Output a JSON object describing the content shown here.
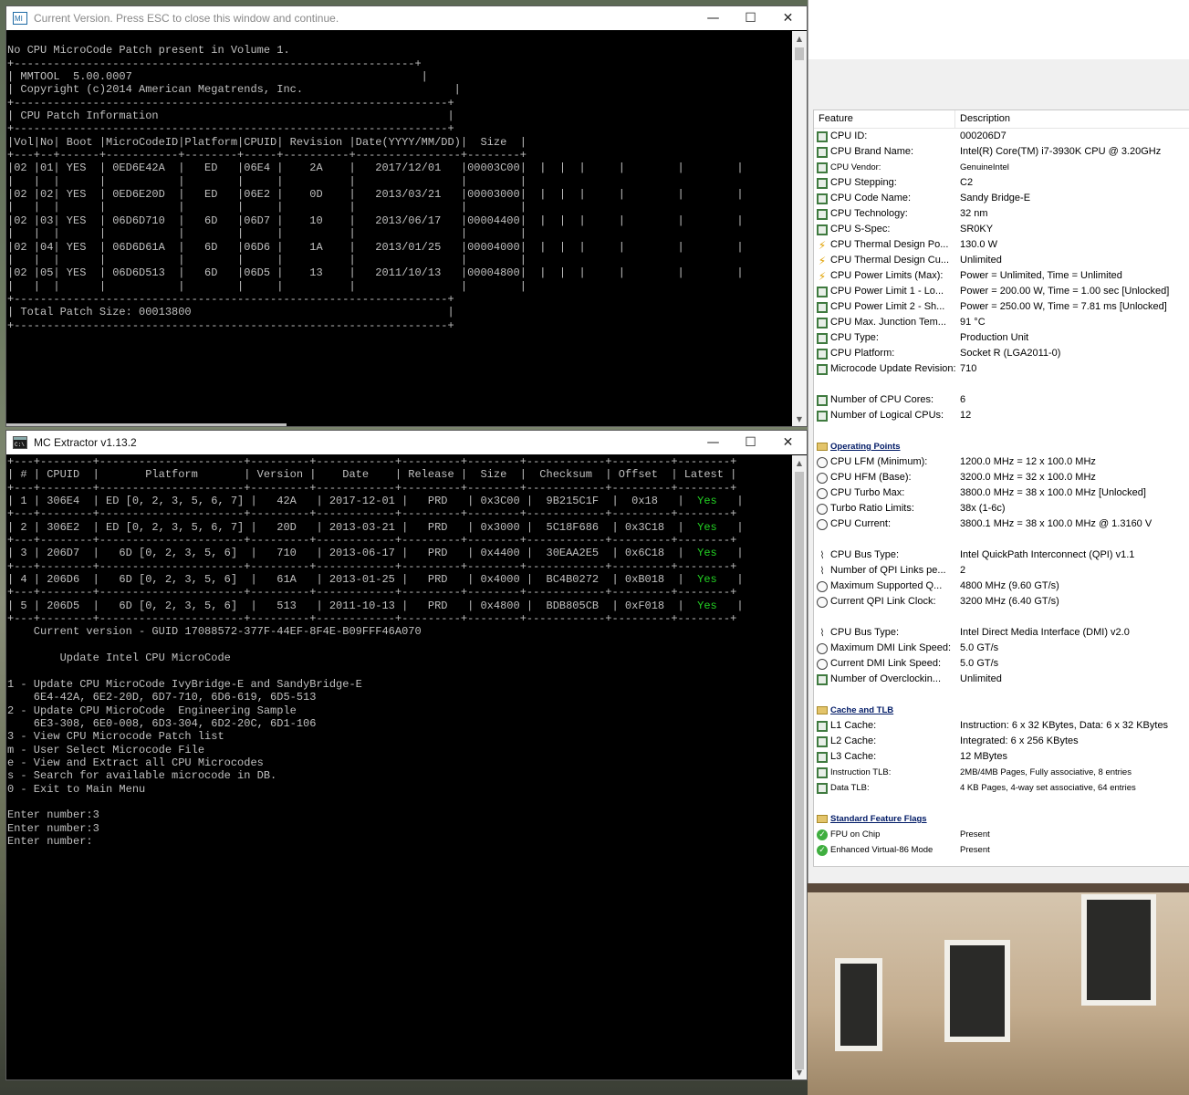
{
  "mmtool_window": {
    "title": "Current Version. Press ESC to close this window and continue.",
    "controls": {
      "minimize": "—",
      "maximize": "☐",
      "close": "✕"
    },
    "console_lines": [
      "",
      "No CPU MicroCode Patch present in Volume 1.",
      "+-------------------------------------------------------------+",
      "| MMTOOL  5.00.0007                                            |",
      "| Copyright (c)2014 American Megatrends, Inc.                       |",
      "+------------------------------------------------------------------+",
      "| CPU Patch Information                                            |",
      "+------------------------------------------------------------------+",
      "|Vol|No| Boot |MicroCodeID|Platform|CPUID| Revision |Date(YYYY/MM/DD)|  Size  |",
      "+---+--+------+-----------+--------+-----+----------+----------------+--------+",
      "|02 |01| YES  | 0ED6E42A  |   ED   |06E4 |    2A    |   2017/12/01   |00003C00|  |  |  |     |        |        |",
      "|   |  |      |           |        |     |          |                |        |",
      "|02 |02| YES  | 0ED6E20D  |   ED   |06E2 |    0D    |   2013/03/21   |00003000|  |  |  |     |        |        |",
      "|   |  |      |           |        |     |          |                |        |",
      "|02 |03| YES  | 06D6D710  |   6D   |06D7 |    10    |   2013/06/17   |00004400|  |  |  |     |        |        |",
      "|   |  |      |           |        |     |          |                |        |",
      "|02 |04| YES  | 06D6D61A  |   6D   |06D6 |    1A    |   2013/01/25   |00004000|  |  |  |     |        |        |",
      "|   |  |      |           |        |     |          |                |        |",
      "|02 |05| YES  | 06D6D513  |   6D   |06D5 |    13    |   2011/10/13   |00004800|  |  |  |     |        |        |",
      "|   |  |      |           |        |     |          |                |        |",
      "+------------------------------------------------------------------+",
      "| Total Patch Size: 00013800                                       |",
      "+------------------------------------------------------------------+"
    ]
  },
  "mcextractor_window": {
    "title": "MC Extractor v1.13.2",
    "controls": {
      "minimize": "—",
      "maximize": "☐",
      "close": "✕"
    },
    "table": {
      "border": "+---+--------+----------------------+---------+------------+---------+--------+------------+---------+--------+",
      "header": "| # | CPUID  |       Platform       | Version |    Date    | Release |  Size  |  Checksum  | Offset  | Latest |",
      "rows": [
        {
          "pre": "| 1 | 306E4  | ED [0, 2, 3, 5, 6, 7] |   42A   | 2017-12-01 |   PRD   | 0x3C00 |  9B215C1F  |  0x18   |  ",
          "latest": "Yes",
          "post": "   |"
        },
        {
          "pre": "| 2 | 306E2  | ED [0, 2, 3, 5, 6, 7] |   20D   | 2013-03-21 |   PRD   | 0x3000 |  5C18F686  | 0x3C18  |  ",
          "latest": "Yes",
          "post": "   |"
        },
        {
          "pre": "| 3 | 206D7  |   6D [0, 2, 3, 5, 6]  |   710   | 2013-06-17 |   PRD   | 0x4400 |  30EAA2E5  | 0x6C18  |  ",
          "latest": "Yes",
          "post": "   |"
        },
        {
          "pre": "| 4 | 206D6  |   6D [0, 2, 3, 5, 6]  |   61A   | 2013-01-25 |   PRD   | 0x4000 |  BC4B0272  | 0xB018  |  ",
          "latest": "Yes",
          "post": "   |"
        },
        {
          "pre": "| 5 | 206D5  |   6D [0, 2, 3, 5, 6]  |   513   | 2011-10-13 |   PRD   | 0x4800 |  BDB805CB  | 0xF018  |  ",
          "latest": "Yes",
          "post": "   |"
        }
      ]
    },
    "menu_lines": [
      "    Current version - GUID 17088572-377F-44EF-8F4E-B09FFF46A070",
      "",
      "        Update Intel CPU MicroCode",
      "",
      "1 - Update CPU MicroCode IvyBridge-E and SandyBridge-E",
      "    6E4-42A, 6E2-20D, 6D7-710, 6D6-619, 6D5-513",
      "2 - Update CPU MicroCode  Engineering Sample",
      "    6E3-308, 6E0-008, 6D3-304, 6D2-20C, 6D1-106",
      "3 - View CPU Microcode Patch list",
      "m - User Select Microcode File",
      "e - View and Extract all CPU Microcodes",
      "s - Search for available microcode in DB.",
      "0 - Exit to Main Menu",
      "",
      "Enter number:3",
      "Enter number:3",
      "Enter number:"
    ]
  },
  "feature_panel": {
    "column_feature": "Feature",
    "column_description": "Description",
    "rows": [
      {
        "icon": "chip",
        "feature": "CPU ID:",
        "value": "000206D7"
      },
      {
        "icon": "chip",
        "feature": "CPU Brand Name:",
        "value": "Intel(R) Core(TM) i7-3930K CPU @ 3.20GHz"
      },
      {
        "icon": "chip",
        "feature": "CPU Vendor:",
        "value": "GenuineIntel",
        "small": true
      },
      {
        "icon": "chip",
        "feature": "CPU Stepping:",
        "value": "C2"
      },
      {
        "icon": "chip",
        "feature": "CPU Code Name:",
        "value": "Sandy Bridge-E"
      },
      {
        "icon": "chip",
        "feature": "CPU Technology:",
        "value": "32 nm"
      },
      {
        "icon": "chip",
        "feature": "CPU S-Spec:",
        "value": "SR0KY"
      },
      {
        "icon": "bolt",
        "feature": "CPU Thermal Design Po...",
        "value": "130.0 W"
      },
      {
        "icon": "bolt",
        "feature": "CPU Thermal Design Cu...",
        "value": "Unlimited"
      },
      {
        "icon": "bolt",
        "feature": "CPU Power Limits (Max):",
        "value": "Power = Unlimited, Time = Unlimited"
      },
      {
        "icon": "chip",
        "feature": "CPU Power Limit 1 - Lo...",
        "value": "Power = 200.00 W, Time = 1.00 sec [Unlocked]"
      },
      {
        "icon": "chip",
        "feature": "CPU Power Limit 2 - Sh...",
        "value": "Power = 250.00 W, Time = 7.81 ms [Unlocked]"
      },
      {
        "icon": "chip",
        "feature": "CPU Max. Junction Tem...",
        "value": "91 °C"
      },
      {
        "icon": "chip",
        "feature": "CPU Type:",
        "value": "Production Unit"
      },
      {
        "icon": "chip",
        "feature": "CPU Platform:",
        "value": "Socket R (LGA2011-0)"
      },
      {
        "icon": "chip",
        "feature": "Microcode Update Revision:",
        "value": "710"
      },
      {
        "spacer": true
      },
      {
        "icon": "chip",
        "feature": "Number of CPU Cores:",
        "value": "6"
      },
      {
        "icon": "chip",
        "feature": "Number of Logical CPUs:",
        "value": "12"
      },
      {
        "spacer": true
      },
      {
        "icon": "sect",
        "feature": "Operating Points",
        "section": true
      },
      {
        "icon": "gauge",
        "feature": "CPU LFM (Minimum):",
        "value": "1200.0 MHz = 12 x 100.0 MHz"
      },
      {
        "icon": "gauge",
        "feature": "CPU HFM (Base):",
        "value": "3200.0 MHz = 32 x 100.0 MHz"
      },
      {
        "icon": "gauge",
        "feature": "CPU Turbo Max:",
        "value": "3800.0 MHz = 38 x 100.0 MHz [Unlocked]"
      },
      {
        "icon": "gauge",
        "feature": "Turbo Ratio Limits:",
        "value": "38x (1-6c)"
      },
      {
        "icon": "gauge",
        "feature": "CPU Current:",
        "value": "3800.1 MHz = 38 x 100.0 MHz @ 1.3160 V"
      },
      {
        "spacer": true
      },
      {
        "icon": "bus",
        "feature": "CPU Bus Type:",
        "value": "Intel QuickPath Interconnect (QPI) v1.1"
      },
      {
        "icon": "bus",
        "feature": "Number of QPI Links pe...",
        "value": "2"
      },
      {
        "icon": "gauge",
        "feature": "Maximum Supported Q...",
        "value": "4800 MHz (9.60 GT/s)"
      },
      {
        "icon": "gauge",
        "feature": "Current QPI Link Clock:",
        "value": "3200 MHz (6.40 GT/s)"
      },
      {
        "spacer": true
      },
      {
        "icon": "bus",
        "feature": "CPU Bus Type:",
        "value": "Intel Direct Media Interface (DMI) v2.0"
      },
      {
        "icon": "gauge",
        "feature": "Maximum DMI Link Speed:",
        "value": "5.0 GT/s"
      },
      {
        "icon": "gauge",
        "feature": "Current DMI Link Speed:",
        "value": "5.0 GT/s"
      },
      {
        "icon": "chip",
        "feature": "Number of Overclockin...",
        "value": "Unlimited"
      },
      {
        "spacer": true
      },
      {
        "icon": "sect",
        "feature": "Cache and TLB",
        "section": true
      },
      {
        "icon": "chip",
        "feature": "L1 Cache:",
        "value": "Instruction: 6 x 32 KBytes, Data: 6 x 32 KBytes"
      },
      {
        "icon": "chip",
        "feature": "L2 Cache:",
        "value": "Integrated: 6 x 256 KBytes"
      },
      {
        "icon": "chip",
        "feature": "L3 Cache:",
        "value": "12 MBytes"
      },
      {
        "icon": "chip",
        "feature": "Instruction TLB:",
        "value": "2MB/4MB Pages, Fully associative, 8 entries",
        "small": true
      },
      {
        "icon": "chip",
        "feature": "Data TLB:",
        "value": "4 KB Pages, 4-way set associative, 64 entries",
        "small": true
      },
      {
        "spacer": true
      },
      {
        "icon": "sect",
        "feature": "Standard Feature Flags",
        "section": true
      },
      {
        "icon": "check",
        "feature": "FPU on Chip",
        "value": "Present",
        "small": true
      },
      {
        "icon": "check",
        "feature": "Enhanced Virtual-86 Mode",
        "value": "Present",
        "small": true
      }
    ]
  }
}
